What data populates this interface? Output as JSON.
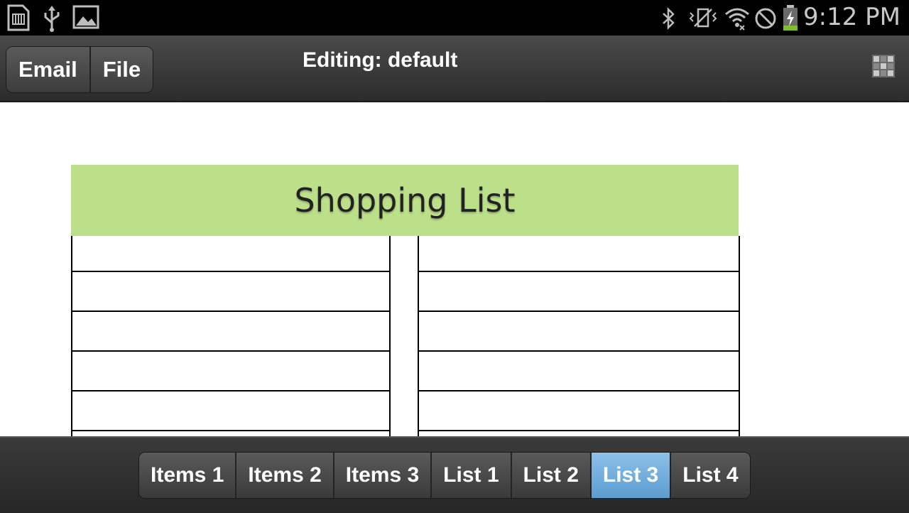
{
  "status_bar": {
    "time": "9:12 PM",
    "left_icons": [
      "sd-card-icon",
      "usb-icon",
      "picture-icon"
    ],
    "right_icons": [
      "bluetooth-icon",
      "vibrate-icon",
      "wifi-icon",
      "do-not-disturb-icon",
      "battery-charging-icon"
    ]
  },
  "toolbar": {
    "email_label": "Email",
    "file_label": "File",
    "title": "Editing: default"
  },
  "list": {
    "title": "Shopping List",
    "header_color": "#bcdf8a"
  },
  "tabs": [
    {
      "label": "Items 1"
    },
    {
      "label": "Items 2"
    },
    {
      "label": "Items 3"
    },
    {
      "label": "List 1"
    },
    {
      "label": "List 2"
    },
    {
      "label": "List 3",
      "active": true
    },
    {
      "label": "List 4"
    }
  ]
}
